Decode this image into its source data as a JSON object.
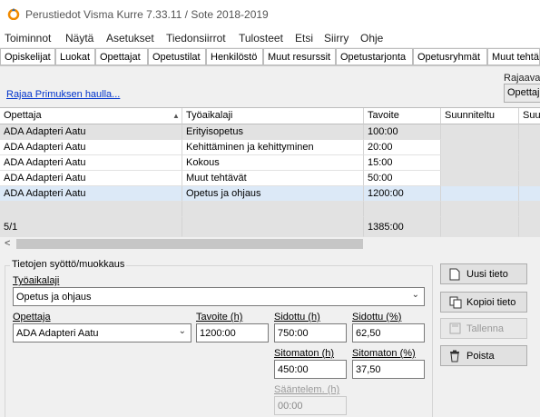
{
  "window": {
    "title": "Perustiedot Visma Kurre 7.33.11 / Sote 2018-2019",
    "app_icon": "kurre-app-icon"
  },
  "menu": [
    "Toiminnot",
    "Näytä",
    "Asetukset",
    "Tiedonsiirrot",
    "Tulosteet",
    "Etsi",
    "Siirry",
    "Ohje"
  ],
  "tabs": [
    "Opiskelijat",
    "Luokat",
    "Opettajat",
    "Opetustilat",
    "Henkilöstö",
    "Muut resurssit",
    "Opetustarjonta",
    "Opetusryhmät",
    "Muut tehtä"
  ],
  "filter": {
    "primus_link": "Rajaa Primuksen haulla...",
    "rajaa_label": "Rajaava",
    "rajaa_value": "Opettaj"
  },
  "grid": {
    "columns": [
      "Opettaja",
      "Työaikalaji",
      "Tavoite",
      "Suunniteltu",
      "Suun"
    ],
    "sort_icon": "sort-ascending-icon",
    "rows": [
      [
        "ADA Adapteri Aatu",
        "Erityisopetus",
        "100:00",
        "",
        ""
      ],
      [
        "ADA Adapteri Aatu",
        "Kehittäminen ja kehittyminen",
        "20:00",
        "",
        ""
      ],
      [
        "ADA Adapteri Aatu",
        "Kokous",
        "15:00",
        "",
        ""
      ],
      [
        "ADA Adapteri Aatu",
        "Muut tehtävät",
        "50:00",
        "",
        ""
      ],
      [
        "ADA Adapteri Aatu",
        "Opetus ja ohjaus",
        "1200:00",
        "",
        ""
      ]
    ],
    "selected_row": 4,
    "footer": [
      "5/1",
      "",
      "1385:00",
      "",
      ""
    ]
  },
  "editor": {
    "group_title": "Tietojen syöttö/muokkaus",
    "tyoaikalaji_label": "Työaikalaji",
    "tyoaikalaji_value": "Opetus ja ohjaus",
    "opettaja_label": "Opettaja",
    "opettaja_value": "ADA Adapteri Aatu",
    "tavoite_label": "Tavoite (h)",
    "tavoite_value": "1200:00",
    "sidottu_h_label": "Sidottu (h)",
    "sidottu_h_value": "750:00",
    "sidottu_pct_label": "Sidottu (%)",
    "sidottu_pct_value": "62,50",
    "sitomaton_h_label": "Sitomaton (h)",
    "sitomaton_h_value": "450:00",
    "sitomaton_pct_label": "Sitomaton (%)",
    "sitomaton_pct_value": "37,50",
    "saantelem_label": "Sääntelem. (h)",
    "saantelem_value": "00:00"
  },
  "buttons": {
    "new": "Uusi tieto",
    "copy": "Kopioi tieto",
    "save": "Tallenna",
    "delete": "Poista"
  },
  "icons": {
    "new": "new-document-icon",
    "copy": "copy-icon",
    "save": "save-disk-icon",
    "delete": "trash-icon",
    "dropdown": "chevron-down-icon"
  },
  "colors": {
    "selected_row": "#dce9f7",
    "link": "#0033cc",
    "app_icon_orange": "#f08a00"
  }
}
